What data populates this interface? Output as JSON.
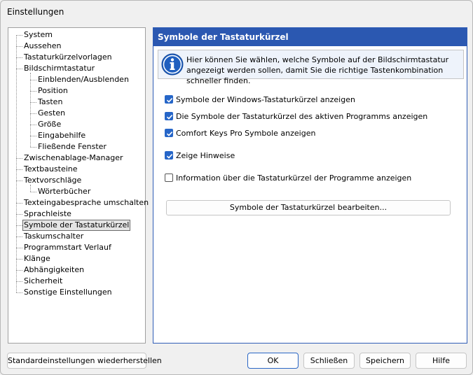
{
  "window": {
    "title": "Einstellungen"
  },
  "tree": {
    "items": [
      {
        "label": "System",
        "level": 0
      },
      {
        "label": "Aussehen",
        "level": 0
      },
      {
        "label": "Tastaturkürzelvorlagen",
        "level": 0
      },
      {
        "label": "Bildschirmtastatur",
        "level": 0
      },
      {
        "label": "Einblenden/Ausblenden",
        "level": 1
      },
      {
        "label": "Position",
        "level": 1
      },
      {
        "label": "Tasten",
        "level": 1
      },
      {
        "label": "Gesten",
        "level": 1
      },
      {
        "label": "Größe",
        "level": 1
      },
      {
        "label": "Eingabehilfe",
        "level": 1
      },
      {
        "label": "Fließende Fenster",
        "level": 1
      },
      {
        "label": "Zwischenablage-Manager",
        "level": 0
      },
      {
        "label": "Textbausteine",
        "level": 0
      },
      {
        "label": "Textvorschläge",
        "level": 0
      },
      {
        "label": "Wörterbücher",
        "level": 1
      },
      {
        "label": "Texteingabesprache umschalten",
        "level": 0
      },
      {
        "label": "Sprachleiste",
        "level": 0
      },
      {
        "label": "Symbole der Tastaturkürzel",
        "level": 0,
        "selected": true
      },
      {
        "label": "Taskumschalter",
        "level": 0
      },
      {
        "label": "Programmstart Verlauf",
        "level": 0
      },
      {
        "label": "Klänge",
        "level": 0
      },
      {
        "label": "Abhängigkeiten",
        "level": 0
      },
      {
        "label": "Sicherheit",
        "level": 0
      },
      {
        "label": "Sonstige Einstellungen",
        "level": 0
      }
    ]
  },
  "panel": {
    "title": "Symbole der Tastaturkürzel",
    "info_text": "Hier können Sie wählen, welche Symbole auf der Bildschirmtastatur angezeigt werden sollen, damit Sie die richtige Tastenkombination schneller finden.",
    "checkboxes": [
      {
        "label": "Symbole der Windows-Tastaturkürzel anzeigen",
        "checked": true
      },
      {
        "label": "Die Symbole der Tastaturkürzel des aktiven Programms anzeigen",
        "checked": true
      },
      {
        "label": "Comfort Keys Pro Symbole anzeigen",
        "checked": true
      },
      {
        "label": "Zeige Hinweise",
        "checked": true
      },
      {
        "label": "Information über die Tastaturkürzel der Programme anzeigen",
        "checked": false
      }
    ],
    "edit_button": "Symbole der Tastaturkürzel bearbeiten..."
  },
  "footer": {
    "restore_label": "Standardeinstellungen wiederherstellen",
    "ok_label": "OK",
    "close_label": "Schließen",
    "save_label": "Speichern",
    "help_label": "Hilfe"
  },
  "colors": {
    "header_bg": "#2b58b1",
    "checkbox_on": "#2666c8",
    "info_icon": "#1f5fbf"
  },
  "icons": {
    "info": "info-icon"
  }
}
